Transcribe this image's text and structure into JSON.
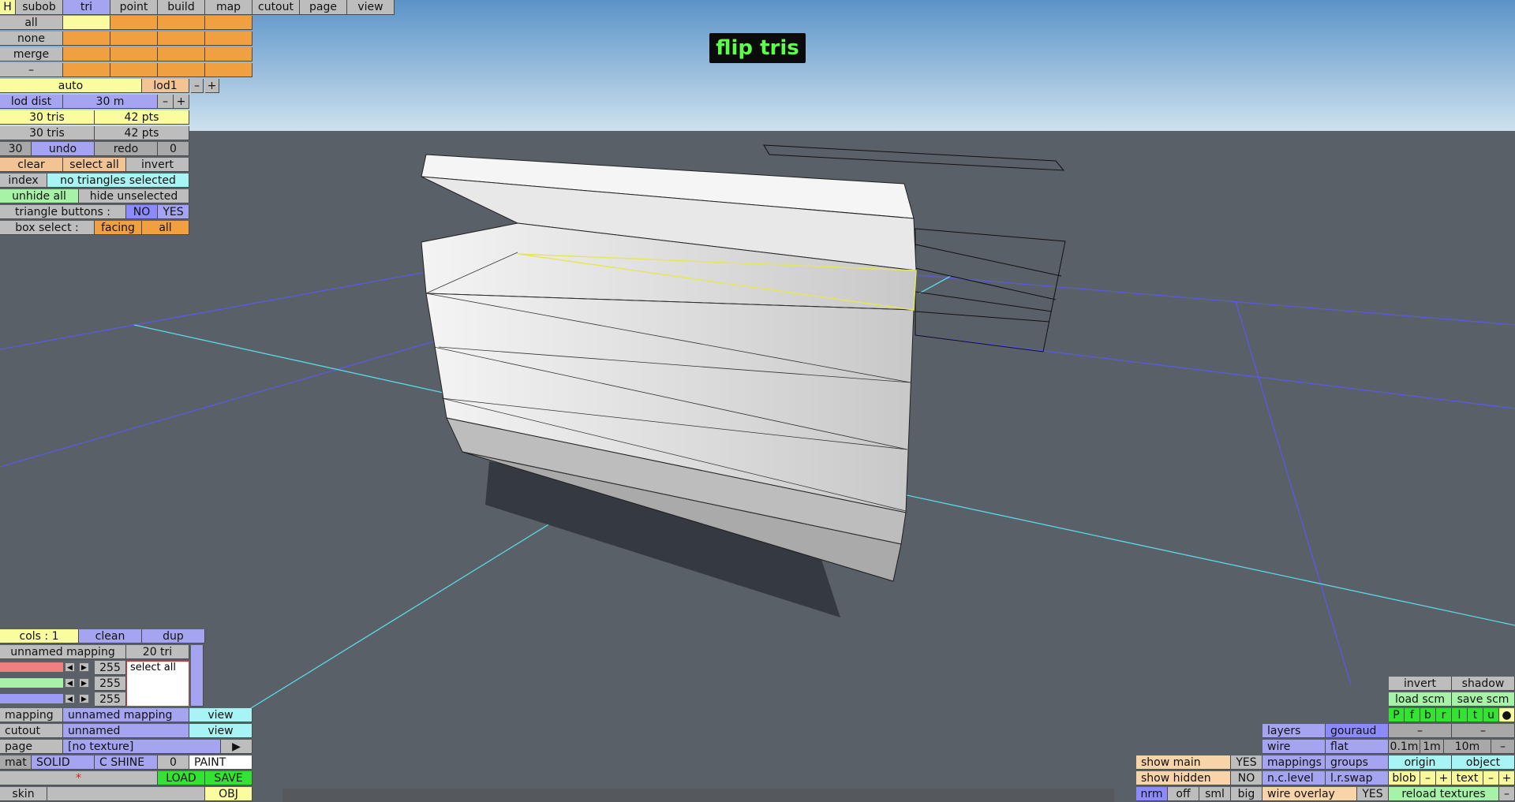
{
  "banner": "flip tris",
  "menu": {
    "h": "H",
    "items": [
      "subob",
      "tri",
      "point",
      "build",
      "map",
      "cutout",
      "page",
      "view"
    ]
  },
  "select": {
    "all": "all",
    "none": "none",
    "merge": "merge",
    "dash": "–"
  },
  "lod": {
    "auto": "auto",
    "name": "lod1",
    "minus": "–",
    "plus": "+",
    "dist_label": "lod dist",
    "dist_value": "30 m"
  },
  "counts": {
    "tris1": "30 tris",
    "pts1": "42 pts",
    "tris2": "30 tris",
    "pts2": "42 pts"
  },
  "history": {
    "count": "30",
    "undo": "undo",
    "redo": "redo",
    "redo_count": "0"
  },
  "ops": {
    "clear": "clear",
    "select_all": "select all",
    "invert": "invert"
  },
  "index": {
    "label": "index",
    "status": "no triangles selected"
  },
  "hide": {
    "unhide_all": "unhide all",
    "hide_unselected": "hide unselected"
  },
  "tri_buttons": {
    "label": "triangle buttons :",
    "no": "NO",
    "yes": "YES"
  },
  "box_select": {
    "label": "box select :",
    "facing": "facing",
    "all": "all"
  },
  "cols": {
    "label": "cols : 1",
    "clean": "clean",
    "dup": "dup"
  },
  "mapping_panel": {
    "name": "unnamed mapping",
    "tri_count": "20 tri",
    "select_all": "select all",
    "r": "255",
    "g": "255",
    "b": "255",
    "left": "◀",
    "right": "▶"
  },
  "mapping": {
    "label": "mapping",
    "value": "unnamed mapping",
    "view": "view"
  },
  "cutout": {
    "label": "cutout",
    "value": "unnamed",
    "view": "view"
  },
  "page": {
    "label": "page",
    "value": "[no texture]",
    "arrow": "▶"
  },
  "mat": {
    "label": "mat",
    "solid": "SOLID",
    "cshine": "C SHINE",
    "zero": "0",
    "paint": "PAINT"
  },
  "file": {
    "star": "*",
    "load": "LOAD",
    "save": "SAVE",
    "obj": "OBJ"
  },
  "skin": {
    "label": "skin"
  },
  "right": {
    "invert": "invert",
    "shadow": "shadow",
    "load_scm": "load scm",
    "save_scm": "save scm",
    "letters": [
      "P",
      "f",
      "b",
      "r",
      "l",
      "t",
      "u",
      "●"
    ],
    "layers": "layers",
    "gouraud": "gouraud",
    "dash1": "–",
    "dash2": "–",
    "wire": "wire",
    "flat": "flat",
    "d01": "0.1m",
    "d1": "1m",
    "d10": "10m",
    "dm": "–",
    "show_main": "show main",
    "show_main_v": "YES",
    "mappings": "mappings",
    "groups": "groups",
    "origin": "origin",
    "object": "object",
    "show_hidden": "show hidden",
    "show_hidden_v": "NO",
    "nclevel": "n.c.level",
    "lrswap": "l.r.swap",
    "blob": "blob",
    "minus": "–",
    "plus": "+",
    "text": "text",
    "tminus": "–",
    "tplus": "+",
    "nrm": "nrm",
    "off": "off",
    "sml": "sml",
    "big": "big",
    "wire_overlay": "wire overlay",
    "wire_overlay_v": "YES",
    "reload": "reload textures",
    "rminus": "–"
  },
  "colors": {
    "sky_top": "#5b93c8",
    "sky_bottom": "#c9dfee",
    "ground": "#5a6068"
  }
}
